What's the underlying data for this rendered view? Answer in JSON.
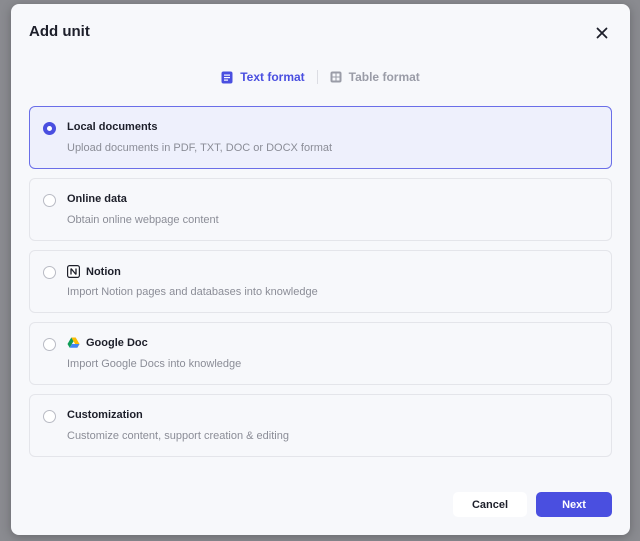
{
  "dialog": {
    "title": "Add unit",
    "close_icon": "close-icon"
  },
  "tabs": [
    {
      "label": "Text format",
      "icon": "document-icon",
      "active": true
    },
    {
      "label": "Table format",
      "icon": "table-icon",
      "active": false
    }
  ],
  "options": [
    {
      "title": "Local documents",
      "description": "Upload documents in PDF, TXT, DOC or DOCX format",
      "selected": true,
      "icon": null
    },
    {
      "title": "Online data",
      "description": "Obtain online webpage content",
      "selected": false,
      "icon": null
    },
    {
      "title": "Notion",
      "description": "Import Notion pages and databases into knowledge",
      "selected": false,
      "icon": "notion-icon"
    },
    {
      "title": "Google Doc",
      "description": "Import Google Docs into knowledge",
      "selected": false,
      "icon": "google-drive-icon"
    },
    {
      "title": "Customization",
      "description": "Customize content, support creation & editing",
      "selected": false,
      "icon": null
    }
  ],
  "footer": {
    "cancel_label": "Cancel",
    "next_label": "Next"
  },
  "colors": {
    "accent": "#4a4fe0",
    "selected_bg": "#eef0fc",
    "overlay": "#8a8b90"
  }
}
